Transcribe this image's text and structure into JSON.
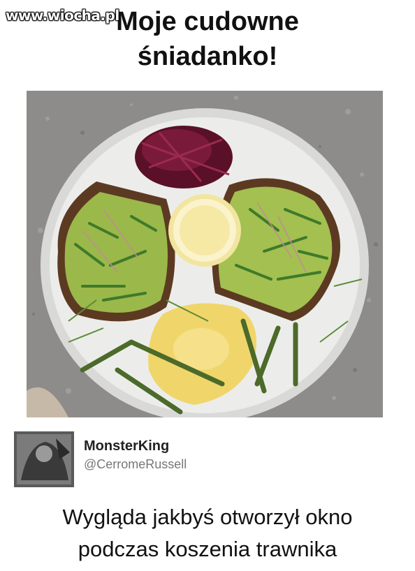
{
  "watermark": "www.wiocha.pl",
  "title": {
    "line1": "Moje cudowne",
    "line2": "śniadanko!"
  },
  "tweet": {
    "name": "MonsterKing",
    "handle": "@CerromeRussell"
  },
  "caption": {
    "line1": "Wygląda jakbyś otworzył okno",
    "line2": "podczas koszenia trawnika"
  },
  "photo": {
    "icon": "breakfast-plate-photo"
  }
}
